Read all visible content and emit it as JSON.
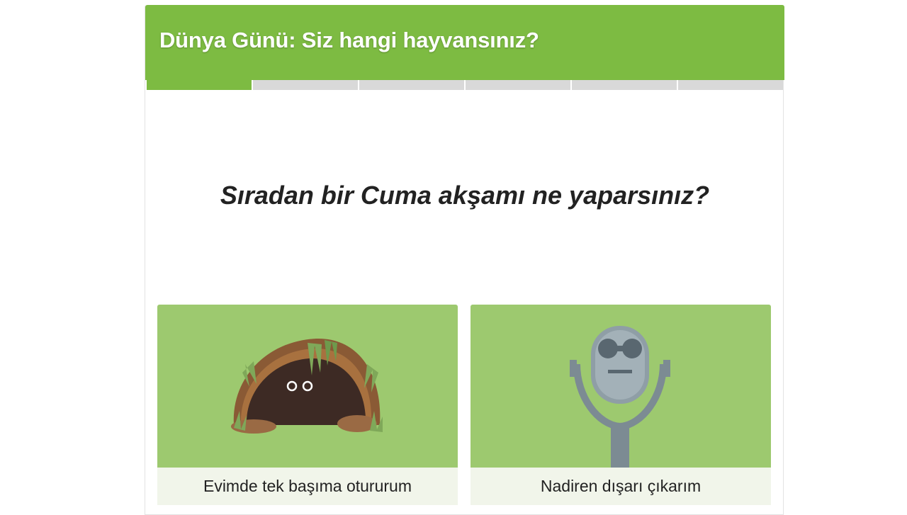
{
  "quiz": {
    "title": "Dünya Günü: Siz hangi hayvansınız?",
    "progress": {
      "current_step": 1,
      "total_steps": 6
    },
    "question": "Sıradan bir Cuma akşamı ne yaparsınız?",
    "answers": [
      {
        "label": "Evimde tek başıma otururum",
        "image_icon": "burrow-with-eyes-icon"
      },
      {
        "label": "Nadiren dışarı çıkarım",
        "image_icon": "coin-binoculars-icon"
      }
    ]
  },
  "colors": {
    "accent_green": "#7dbb42",
    "answer_tile_green": "#9dc96f",
    "label_background": "#f1f5ea",
    "progress_inactive": "#d9d9d9"
  }
}
